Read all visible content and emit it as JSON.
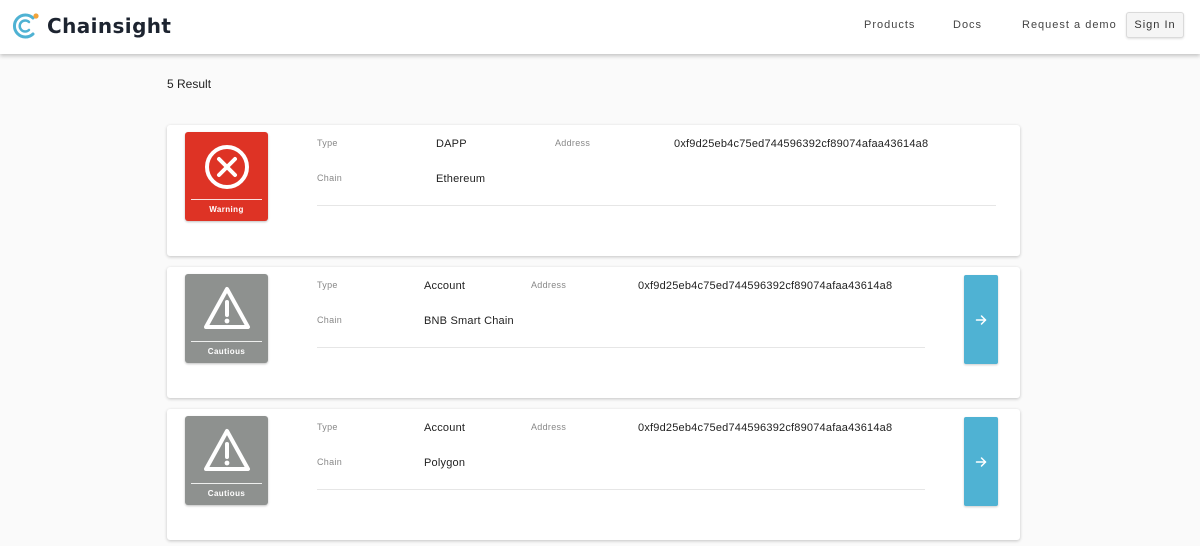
{
  "brand": {
    "name": "Chainsight",
    "logo_icon": "chainsight-logo-icon",
    "accent": "#4fb2d3"
  },
  "nav": {
    "products": "Products",
    "docs": "Docs",
    "request_demo": "Request a demo",
    "sign_in": "Sign In"
  },
  "results": {
    "count_text": "5 Result",
    "cards": [
      {
        "badge": {
          "label": "Warning",
          "icon": "x-circle-icon",
          "color": "#de3325"
        },
        "type_label": "Type",
        "type_value": "DAPP",
        "chain_label": "Chain",
        "chain_value": "Ethereum",
        "address_label": "Address",
        "address_value": "0xf9d25eb4c75ed744596392cf89074afaa43614a8",
        "has_arrow": false
      },
      {
        "badge": {
          "label": "Cautious",
          "icon": "warning-triangle-icon",
          "color": "#8e918f"
        },
        "type_label": "Type",
        "type_value": "Account",
        "chain_label": "Chain",
        "chain_value": "BNB Smart Chain",
        "address_label": "Address",
        "address_value": "0xf9d25eb4c75ed744596392cf89074afaa43614a8",
        "has_arrow": true,
        "arrow_icon": "arrow-right-icon"
      },
      {
        "badge": {
          "label": "Cautious",
          "icon": "warning-triangle-icon",
          "color": "#8e918f"
        },
        "type_label": "Type",
        "type_value": "Account",
        "chain_label": "Chain",
        "chain_value": "Polygon",
        "address_label": "Address",
        "address_value": "0xf9d25eb4c75ed744596392cf89074afaa43614a8",
        "has_arrow": true,
        "arrow_icon": "arrow-right-icon"
      }
    ]
  }
}
